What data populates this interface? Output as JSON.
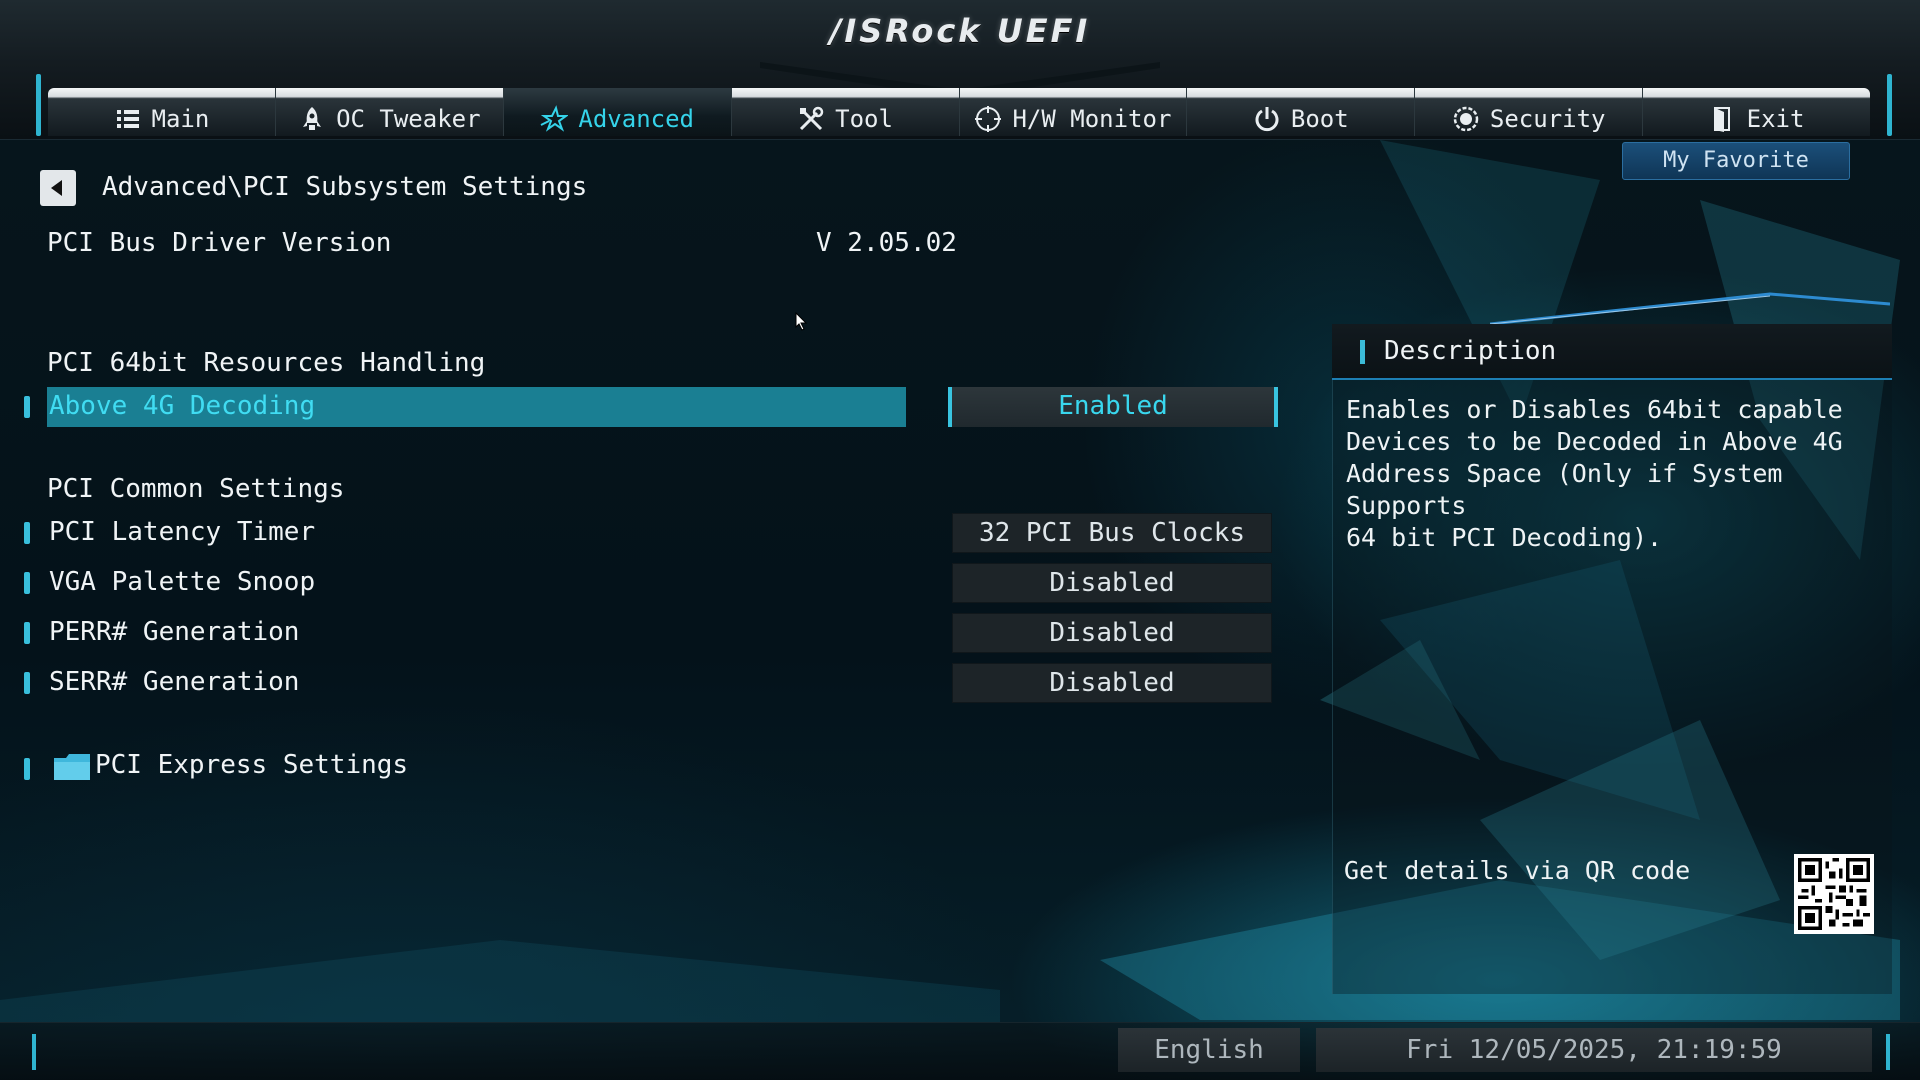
{
  "app": {
    "logo": "/ISRock UEFI"
  },
  "tabs": [
    {
      "label": "Main",
      "icon": "list-icon",
      "active": false
    },
    {
      "label": "OC Tweaker",
      "icon": "rocket-icon",
      "active": false
    },
    {
      "label": "Advanced",
      "icon": "star-icon",
      "active": true
    },
    {
      "label": "Tool",
      "icon": "tools-icon",
      "active": false
    },
    {
      "label": "H/W Monitor",
      "icon": "crosshair-icon",
      "active": false
    },
    {
      "label": "Boot",
      "icon": "power-icon",
      "active": false
    },
    {
      "label": "Security",
      "icon": "shield-icon",
      "active": false
    },
    {
      "label": "Exit",
      "icon": "exit-door-icon",
      "active": false
    }
  ],
  "my_favorite": "My Favorite",
  "breadcrumb": "Advanced\\PCI Subsystem Settings",
  "driver": {
    "label": "PCI Bus Driver Version",
    "value": "V 2.05.02"
  },
  "section_64bit": "PCI 64bit Resources Handling",
  "above4g": {
    "label": "Above 4G Decoding",
    "value": "Enabled"
  },
  "section_common": "PCI Common Settings",
  "settings": [
    {
      "label": "PCI Latency Timer",
      "value": "32 PCI Bus Clocks"
    },
    {
      "label": "VGA Palette Snoop",
      "value": "Disabled"
    },
    {
      "label": "PERR# Generation",
      "value": "Disabled"
    },
    {
      "label": "SERR# Generation",
      "value": "Disabled"
    }
  ],
  "pcie_submenu": "PCI Express Settings",
  "description": {
    "title": "Description",
    "text": "Enables or Disables 64bit capable\nDevices to be Decoded in Above 4G\nAddress Space (Only if System Supports\n64 bit PCI Decoding).",
    "qr_label": "Get details via QR code"
  },
  "footer": {
    "language": "English",
    "datetime": "Fri 12/05/2025, 21:19:59"
  },
  "colors": {
    "accent": "#39d7ee",
    "highlight_row": "#1a7f93",
    "favorite": "#1b4f7a"
  }
}
